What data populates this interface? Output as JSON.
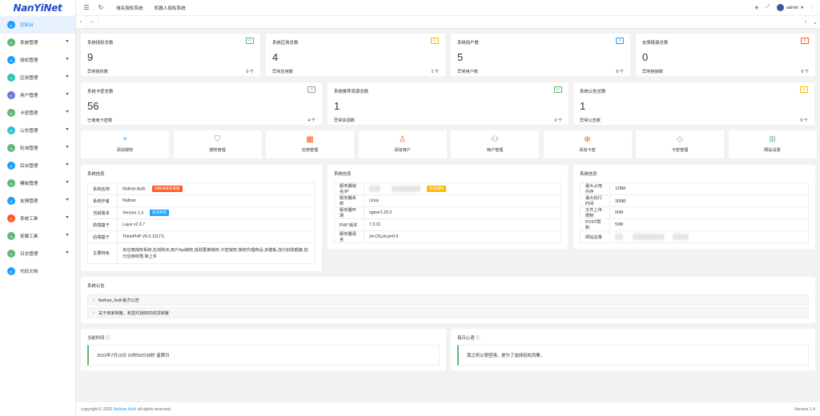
{
  "logo": "NanYiNet",
  "sidebar": {
    "items": [
      {
        "label": "控制台",
        "icon": "console-icon",
        "color": "#1e9fff",
        "arrow": false,
        "active": true
      },
      {
        "label": "系统管理",
        "icon": "system-icon",
        "color": "#5fb878",
        "arrow": true
      },
      {
        "label": "授权管理",
        "icon": "license-icon",
        "color": "#1e9fff",
        "arrow": true
      },
      {
        "label": "应用管理",
        "icon": "app-icon",
        "color": "#2fc2b3",
        "arrow": true
      },
      {
        "label": "用户管理",
        "icon": "user-icon",
        "color": "#6a7ad6",
        "arrow": true
      },
      {
        "label": "卡密管理",
        "icon": "card-icon",
        "color": "#5fb878",
        "arrow": true
      },
      {
        "label": "公告管理",
        "icon": "notice-icon",
        "color": "#3cbcd6",
        "arrow": true
      },
      {
        "label": "轮询管理",
        "icon": "poll-icon",
        "color": "#5fb878",
        "arrow": true
      },
      {
        "label": "后台管理",
        "icon": "backend-icon",
        "color": "#1e9fff",
        "arrow": true
      },
      {
        "label": "模板管理",
        "icon": "template-icon",
        "color": "#5fb878",
        "arrow": true
      },
      {
        "label": "友情管理",
        "icon": "link-icon",
        "color": "#1e9fff",
        "arrow": true
      },
      {
        "label": "系统工具",
        "icon": "tools-icon",
        "color": "#ff5722",
        "arrow": true
      },
      {
        "label": "拓展工具",
        "icon": "extension-icon",
        "color": "#5fb878",
        "arrow": true
      },
      {
        "label": "日志管理",
        "icon": "log-icon",
        "color": "#5fb878",
        "arrow": true
      },
      {
        "label": "代码文档",
        "icon": "doc-icon",
        "color": "#1e9fff",
        "arrow": false
      }
    ]
  },
  "topbar": {
    "tabs": [
      "域名授权系统",
      "机器人授权系统"
    ],
    "user": "admin"
  },
  "stats_row1": [
    {
      "title": "系统授权总数",
      "badge": "个",
      "badge_color": "#5fb878",
      "value": "9",
      "sub": "异常授权数",
      "count": "0 个"
    },
    {
      "title": "系统应用总数",
      "badge": "个",
      "badge_color": "#ffb800",
      "value": "4",
      "sub": "异常应用数",
      "count": "1 个"
    },
    {
      "title": "系统用户数",
      "badge": "个",
      "badge_color": "#1e9fff",
      "value": "5",
      "sub": "异常用户数",
      "count": "0 个"
    },
    {
      "title": "友情链接总数",
      "badge": "个",
      "badge_color": "#ff5722",
      "value": "0",
      "sub": "异常链接数",
      "count": "0 个"
    }
  ],
  "stats_row2": [
    {
      "title": "系统卡密总数",
      "badge": "个",
      "badge_color": "#999999",
      "value": "56",
      "sub": "已使用卡密数",
      "count": "4 个"
    },
    {
      "title": "系统推荐资源总数",
      "badge": "个",
      "badge_color": "#5fb878",
      "value": "1",
      "sub": "异常资源数",
      "count": "0 个"
    },
    {
      "title": "系统公告总数",
      "badge": "个",
      "badge_color": "#ffb800",
      "value": "1",
      "sub": "异常公告数",
      "count": "0 个"
    }
  ],
  "quick": [
    {
      "label": "添加授权",
      "icon": "plus-icon",
      "glyph": "+",
      "color": "#1e9fff"
    },
    {
      "label": "授权管理",
      "icon": "shield-check-icon",
      "glyph": "⛉",
      "color": "#5fb878"
    },
    {
      "label": "应用管理",
      "icon": "apps-icon",
      "glyph": "▦",
      "color": "#ff5722"
    },
    {
      "label": "添加用户",
      "icon": "user-add-icon",
      "glyph": "♙",
      "color": "#ff5722"
    },
    {
      "label": "用户管理",
      "icon": "users-icon",
      "glyph": "⚇",
      "color": "#6a7ad6"
    },
    {
      "label": "添加卡密",
      "icon": "plus-circle-icon",
      "glyph": "⊕",
      "color": "#ff5722"
    },
    {
      "label": "卡密管理",
      "icon": "diamond-icon",
      "glyph": "◇",
      "color": "#5fb878"
    },
    {
      "label": "网站设置",
      "icon": "windows-icon",
      "glyph": "⊞",
      "color": "#5fb878"
    }
  ],
  "info1": {
    "title": "系统信息",
    "rows": [
      {
        "k": "系统名称",
        "v": "Nathan Auth",
        "btn": "进群请联系客服",
        "btn_color": "#ff5722"
      },
      {
        "k": "系统作者",
        "v": "Nathan"
      },
      {
        "k": "当前版本",
        "v": "Version 1.4",
        "btn": "检测更新",
        "btn_color": "#1e9fff"
      },
      {
        "k": "前端基于",
        "v": "Layui v2.3.7"
      },
      {
        "k": "后端基于",
        "v": "ThinkPHP V6.0.12LTS"
      },
      {
        "k": "主要特色",
        "v": "多应用授权系统,在线购买,用户Api授权,自助更换授权,卡密授权,授权代理商设,多模板,加分扣除额度,加分应用权限,简上手"
      }
    ]
  },
  "info2": {
    "title": "系统信息",
    "rows": [
      {
        "k": "服务器域名/IP",
        "v": "",
        "btn": "检测授权",
        "btn_color": "#ffb800"
      },
      {
        "k": "服务器系统",
        "v": "Linux"
      },
      {
        "k": "服务器环境",
        "v": "nginx/1.20.2"
      },
      {
        "k": "PHP 版本",
        "v": "7.3.31"
      },
      {
        "k": "服务器语言",
        "v": "zh-CN,zh;q=0.9"
      }
    ]
  },
  "info3": {
    "title": "系统信息",
    "rows": [
      {
        "k": "最大占用内存",
        "v": "128M"
      },
      {
        "k": "最大执行时间",
        "v": "300秒"
      },
      {
        "k": "文件上传限制",
        "v": "50M"
      },
      {
        "k": "POST限制",
        "v": "50M"
      },
      {
        "k": "网站总量",
        "v": ""
      }
    ]
  },
  "announce": {
    "title": "系统公告",
    "items": [
      "Nathan_Auth官方公告",
      "关于商家制度、和签约授权的收货制度"
    ]
  },
  "time": {
    "title": "当前时间",
    "value": "2022年7月10日 20时59分38秒 星期日"
  },
  "quote": {
    "title": "每日心语",
    "value": "我之所以想坚强，是为了选择轻松而累。"
  },
  "footer": {
    "prefix": "copyright © 2022 ",
    "link": "Nathan Auth",
    "suffix": " all rights reserved.",
    "version": "Version 1.4"
  }
}
